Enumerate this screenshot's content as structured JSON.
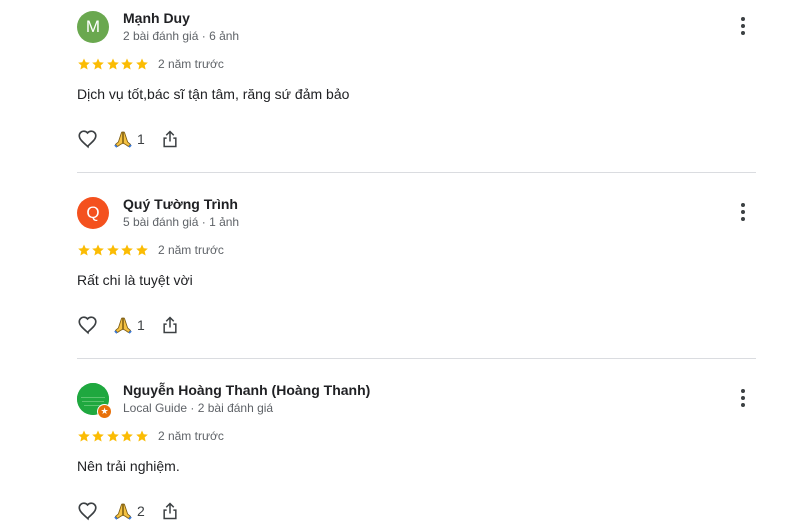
{
  "colors": {
    "star": "#fbbc04",
    "divider": "#dadce0",
    "secondary_text": "#5f6368"
  },
  "icons": {
    "avatar_badge": "star-badge-icon",
    "more": "more-vert-icon",
    "like": "heart-outline-icon",
    "thanks": "folded-hands-icon",
    "share": "share-icon",
    "star": "star-icon"
  },
  "reviews": [
    {
      "avatar_letter": "M",
      "avatar_color": "#6aa84f",
      "name": "Mạnh Duy",
      "meta": "2 bài đánh giá · 6 ảnh",
      "rating": 5,
      "time": "2 năm trước",
      "text": "Dịch vụ tốt,bác sĩ tận tâm, răng sứ đảm bảo",
      "thanks_count": "1"
    },
    {
      "avatar_letter": "Q",
      "avatar_color": "#f4511e",
      "name": "Quý Tường Trình",
      "meta": "5 bài đánh giá · 1 ảnh",
      "rating": 5,
      "time": "2 năm trước",
      "text": "Rất chi là tuyệt vời",
      "thanks_count": "1"
    },
    {
      "avatar_letter": "",
      "avatar_color": "#1fa83f",
      "name": "Nguyễn Hoàng Thanh (Hoàng Thanh)",
      "meta": "Local Guide · 2 bài đánh giá",
      "rating": 5,
      "time": "2 năm trước",
      "text": "Nên trải nghiệm.",
      "thanks_count": "2"
    }
  ]
}
